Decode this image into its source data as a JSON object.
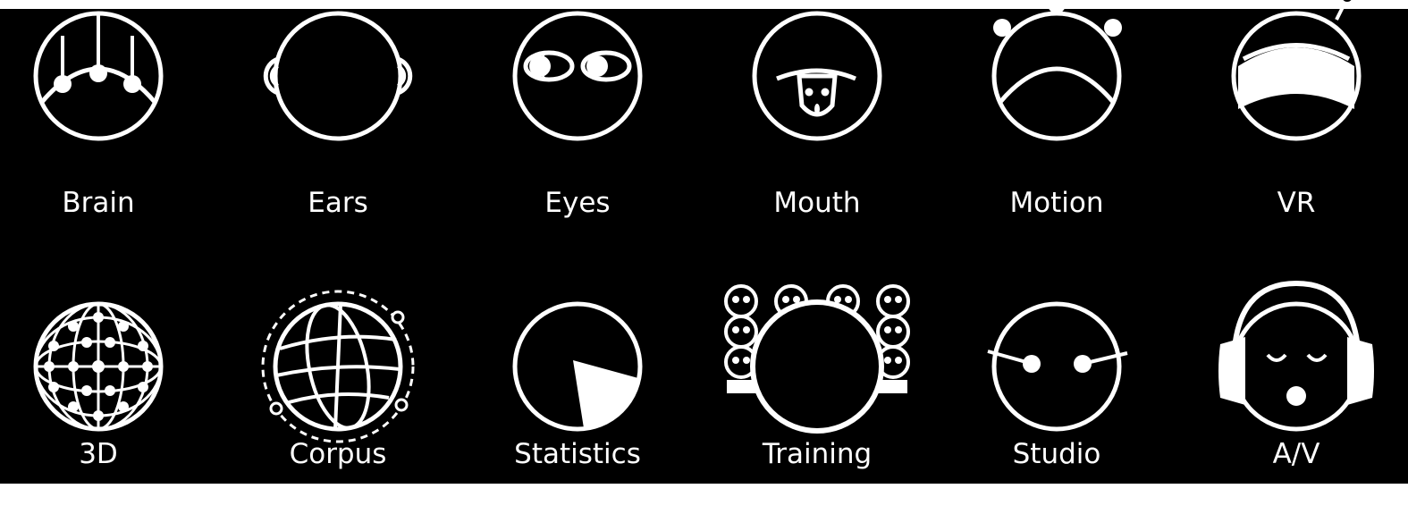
{
  "colors": {
    "background": "#000000",
    "foreground": "#ffffff",
    "frame": "#ffffff"
  },
  "icons": [
    {
      "id": "brain",
      "label": "Brain",
      "icon": "brain-icon"
    },
    {
      "id": "ears",
      "label": "Ears",
      "icon": "ears-icon"
    },
    {
      "id": "eyes",
      "label": "Eyes",
      "icon": "eyes-icon"
    },
    {
      "id": "mouth",
      "label": "Mouth",
      "icon": "mouth-icon"
    },
    {
      "id": "motion",
      "label": "Motion",
      "icon": "motion-icon"
    },
    {
      "id": "vr",
      "label": "VR",
      "icon": "vr-icon"
    },
    {
      "id": "3d",
      "label": "3D",
      "icon": "3d-icon"
    },
    {
      "id": "corpus",
      "label": "Corpus",
      "icon": "corpus-icon"
    },
    {
      "id": "statistics",
      "label": "Statistics",
      "icon": "statistics-icon"
    },
    {
      "id": "training",
      "label": "Training",
      "icon": "training-icon"
    },
    {
      "id": "studio",
      "label": "Studio",
      "icon": "studio-icon"
    },
    {
      "id": "av",
      "label": "A/V",
      "icon": "av-icon"
    }
  ]
}
